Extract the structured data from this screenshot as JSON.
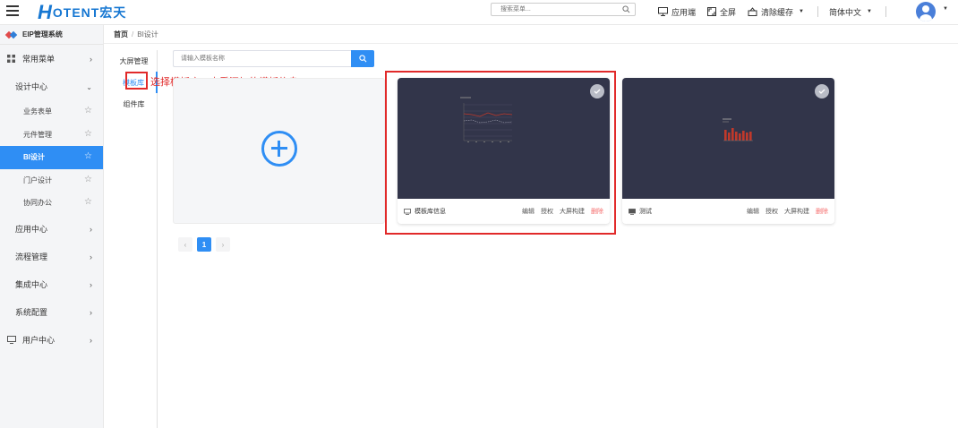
{
  "header": {
    "logo_mark": "H",
    "logo_text": "OTENT宏天",
    "search_placeholder": "搜索菜单...",
    "actions": [
      {
        "label": "应用端",
        "icon": "monitor-icon"
      },
      {
        "label": "全屏",
        "icon": "fullscreen-icon"
      },
      {
        "label": "清除缓存",
        "icon": "broom-icon"
      }
    ],
    "language": "简体中文"
  },
  "sidebar": {
    "system_title": "EIP管理系统",
    "items": [
      {
        "label": "常用菜单"
      },
      {
        "label": "设计中心"
      },
      {
        "label": "应用中心"
      },
      {
        "label": "流程管理"
      },
      {
        "label": "集成中心"
      },
      {
        "label": "系统配置"
      },
      {
        "label": "用户中心"
      }
    ],
    "design_sub": [
      {
        "label": "业务表单"
      },
      {
        "label": "元件管理"
      },
      {
        "label": "BI设计"
      },
      {
        "label": "门户设计"
      },
      {
        "label": "协同办公"
      }
    ],
    "active_sub": "BI设计"
  },
  "breadcrumb": {
    "home": "首页",
    "separator": "/",
    "current": "BI设计"
  },
  "left_tabs": [
    {
      "label": "大屏管理"
    },
    {
      "label": "模板库"
    },
    {
      "label": "组件库"
    }
  ],
  "annotation": "选择模板库，查看添加的模板信息",
  "template_search": {
    "placeholder": "请输入模板名称"
  },
  "cards": [
    {
      "name": "模板库信息",
      "actions": [
        "编辑",
        "授权",
        "大屏构建",
        "删除"
      ]
    },
    {
      "name": "测试",
      "actions": [
        "编辑",
        "授权",
        "大屏构建",
        "删除"
      ]
    }
  ],
  "pagination": {
    "prev": "‹",
    "current": "1",
    "next": "›"
  },
  "colors": {
    "primary": "#2f8ef4",
    "annotation": "#e12a2a",
    "thumb_bg": "#32354a",
    "delete": "#f56c6c"
  }
}
